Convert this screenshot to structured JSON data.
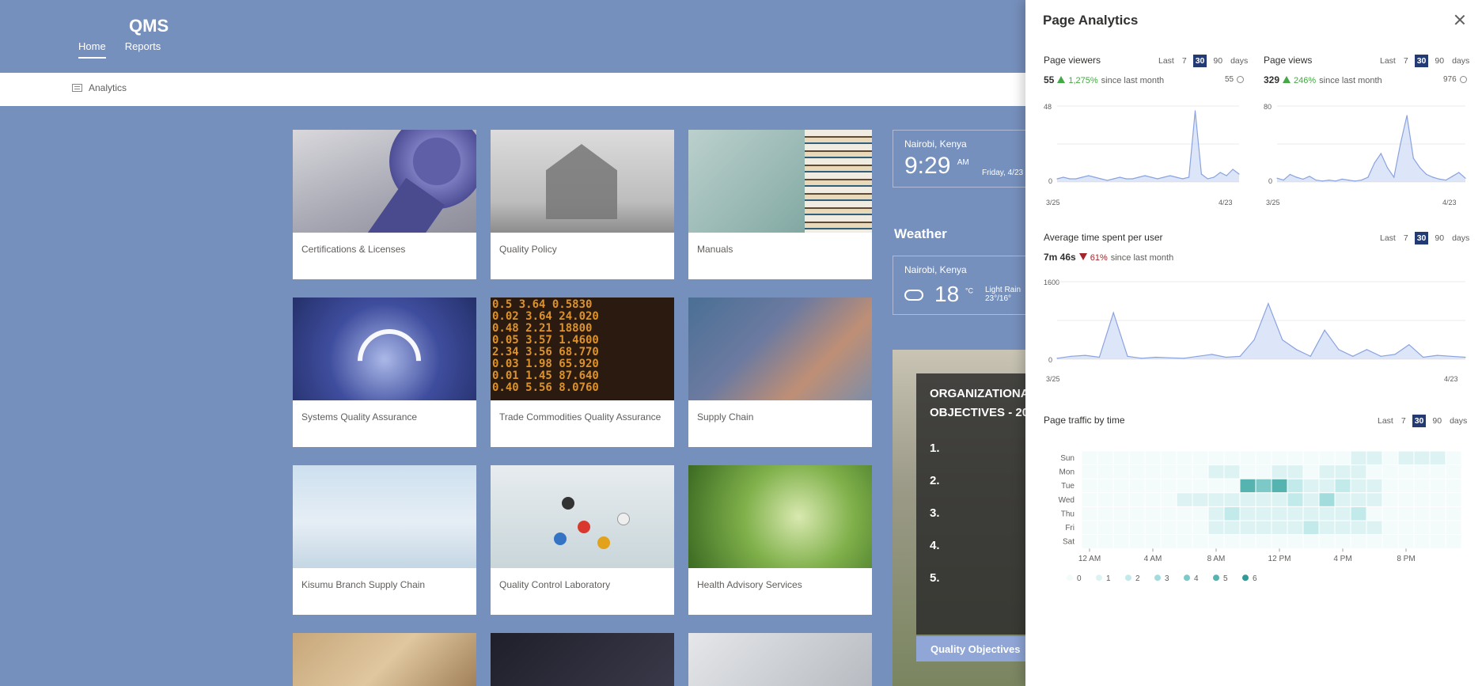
{
  "site": {
    "title": "QMS",
    "nav": [
      "Home",
      "Reports"
    ]
  },
  "command_bar": {
    "analytics_label": "Analytics"
  },
  "tiles": [
    "Certifications & Licenses",
    "Quality Policy",
    "Manuals",
    "Systems Quality Assurance",
    "Trade Commodities Quality Assurance",
    "Supply Chain",
    "Kisumu Branch Supply Chain",
    "Quality Control Laboratory",
    "Health Advisory Services",
    "",
    "",
    ""
  ],
  "trade_tile_numbers": "0.5 3.64 0.5830\n0.02 3.64 24.020\n0.48 2.21 18800\n0.05 3.57 1.4600\n2.34 3.56 68.770\n0.03 1.98 65.920\n0.01 1.45 87.640\n0.40 5.56 8.0760",
  "clock": {
    "location": "Nairobi, Kenya",
    "time": "9:29",
    "ampm": "AM",
    "date": "Friday, 4/23"
  },
  "weather": {
    "title": "Weather",
    "location": "Nairobi, Kenya",
    "temp": "18",
    "unit": "°C",
    "condition": "Light Rain",
    "range": "23°/16°"
  },
  "objectives": {
    "title_line1": "ORGANIZATIONAL",
    "title_line2": "OBJECTIVES - 20",
    "numbers": [
      "1.",
      "2.",
      "3.",
      "4.",
      "5."
    ],
    "button": "Quality Objectives"
  },
  "panel": {
    "title": "Page Analytics",
    "range_label_last": "Last",
    "range_options": [
      "7",
      "30",
      "90"
    ],
    "range_suffix": "days",
    "selected_range": "30",
    "viewers": {
      "title": "Page viewers",
      "value": "55",
      "change": "1,275%",
      "change_dir": "up",
      "since": "since last month",
      "total": "55",
      "chart_data": {
        "type": "area",
        "ylim": [
          0,
          48
        ],
        "yticks": [
          "48",
          "0"
        ],
        "xlabels": [
          "3/25",
          "4/23"
        ],
        "values": [
          2,
          3,
          2,
          2,
          3,
          4,
          3,
          2,
          1,
          2,
          3,
          2,
          2,
          3,
          4,
          3,
          2,
          3,
          4,
          3,
          2,
          3,
          45,
          5,
          2,
          3,
          6,
          4,
          8,
          5
        ]
      }
    },
    "views": {
      "title": "Page views",
      "value": "329",
      "change": "246%",
      "change_dir": "up",
      "since": "since last month",
      "total": "976",
      "chart_data": {
        "type": "area",
        "ylim": [
          0,
          80
        ],
        "yticks": [
          "80",
          "0"
        ],
        "xlabels": [
          "3/25",
          "4/23"
        ],
        "values": [
          4,
          2,
          8,
          5,
          3,
          6,
          2,
          1,
          2,
          1,
          3,
          2,
          1,
          2,
          5,
          20,
          30,
          15,
          5,
          40,
          70,
          25,
          15,
          8,
          5,
          3,
          2,
          6,
          10,
          4
        ]
      }
    },
    "avg_time": {
      "title": "Average time spent per user",
      "value": "7m 46s",
      "change": "61%",
      "change_dir": "down",
      "since": "since last month",
      "chart_data": {
        "type": "area",
        "ylim": [
          0,
          1600
        ],
        "yticks": [
          "1600",
          "0"
        ],
        "xlabels": [
          "3/25",
          "4/23"
        ],
        "values": [
          20,
          60,
          80,
          40,
          960,
          60,
          20,
          40,
          30,
          20,
          60,
          100,
          40,
          60,
          400,
          1150,
          400,
          200,
          60,
          600,
          200,
          60,
          200,
          60,
          100,
          300,
          40,
          80,
          60,
          40
        ]
      }
    },
    "traffic": {
      "title": "Page traffic by time",
      "chart_data": {
        "type": "heatmap",
        "days": [
          "Sun",
          "Mon",
          "Tue",
          "Wed",
          "Thu",
          "Fri",
          "Sat"
        ],
        "hour_labels": [
          "12 AM",
          "4 AM",
          "8 AM",
          "12 PM",
          "4 PM",
          "8 PM"
        ],
        "legend": [
          "0",
          "1",
          "2",
          "3",
          "4",
          "5",
          "6"
        ],
        "values": [
          [
            0,
            0,
            0,
            0,
            0,
            0,
            0,
            0,
            0,
            0,
            0,
            0,
            0,
            0,
            0,
            0,
            0,
            1,
            1,
            0,
            1,
            1,
            1,
            0
          ],
          [
            0,
            0,
            0,
            0,
            0,
            0,
            0,
            0,
            1,
            1,
            0,
            0,
            1,
            1,
            0,
            1,
            1,
            1,
            0,
            0,
            0,
            0,
            0,
            0
          ],
          [
            0,
            0,
            0,
            0,
            0,
            0,
            0,
            0,
            0,
            0,
            5,
            4,
            5,
            2,
            1,
            1,
            2,
            1,
            1,
            0,
            0,
            0,
            0,
            0
          ],
          [
            0,
            0,
            0,
            0,
            0,
            0,
            1,
            1,
            1,
            1,
            1,
            1,
            1,
            2,
            1,
            3,
            1,
            1,
            1,
            0,
            0,
            0,
            0,
            0
          ],
          [
            0,
            0,
            0,
            0,
            0,
            0,
            0,
            0,
            1,
            2,
            1,
            1,
            1,
            1,
            1,
            1,
            1,
            2,
            0,
            0,
            0,
            0,
            0,
            0
          ],
          [
            0,
            0,
            0,
            0,
            0,
            0,
            0,
            0,
            1,
            1,
            1,
            1,
            1,
            1,
            2,
            1,
            1,
            1,
            1,
            0,
            0,
            0,
            0,
            0
          ],
          [
            0,
            0,
            0,
            0,
            0,
            0,
            0,
            0,
            0,
            0,
            0,
            0,
            0,
            0,
            0,
            0,
            0,
            0,
            0,
            0,
            0,
            0,
            0,
            0
          ]
        ]
      }
    }
  }
}
